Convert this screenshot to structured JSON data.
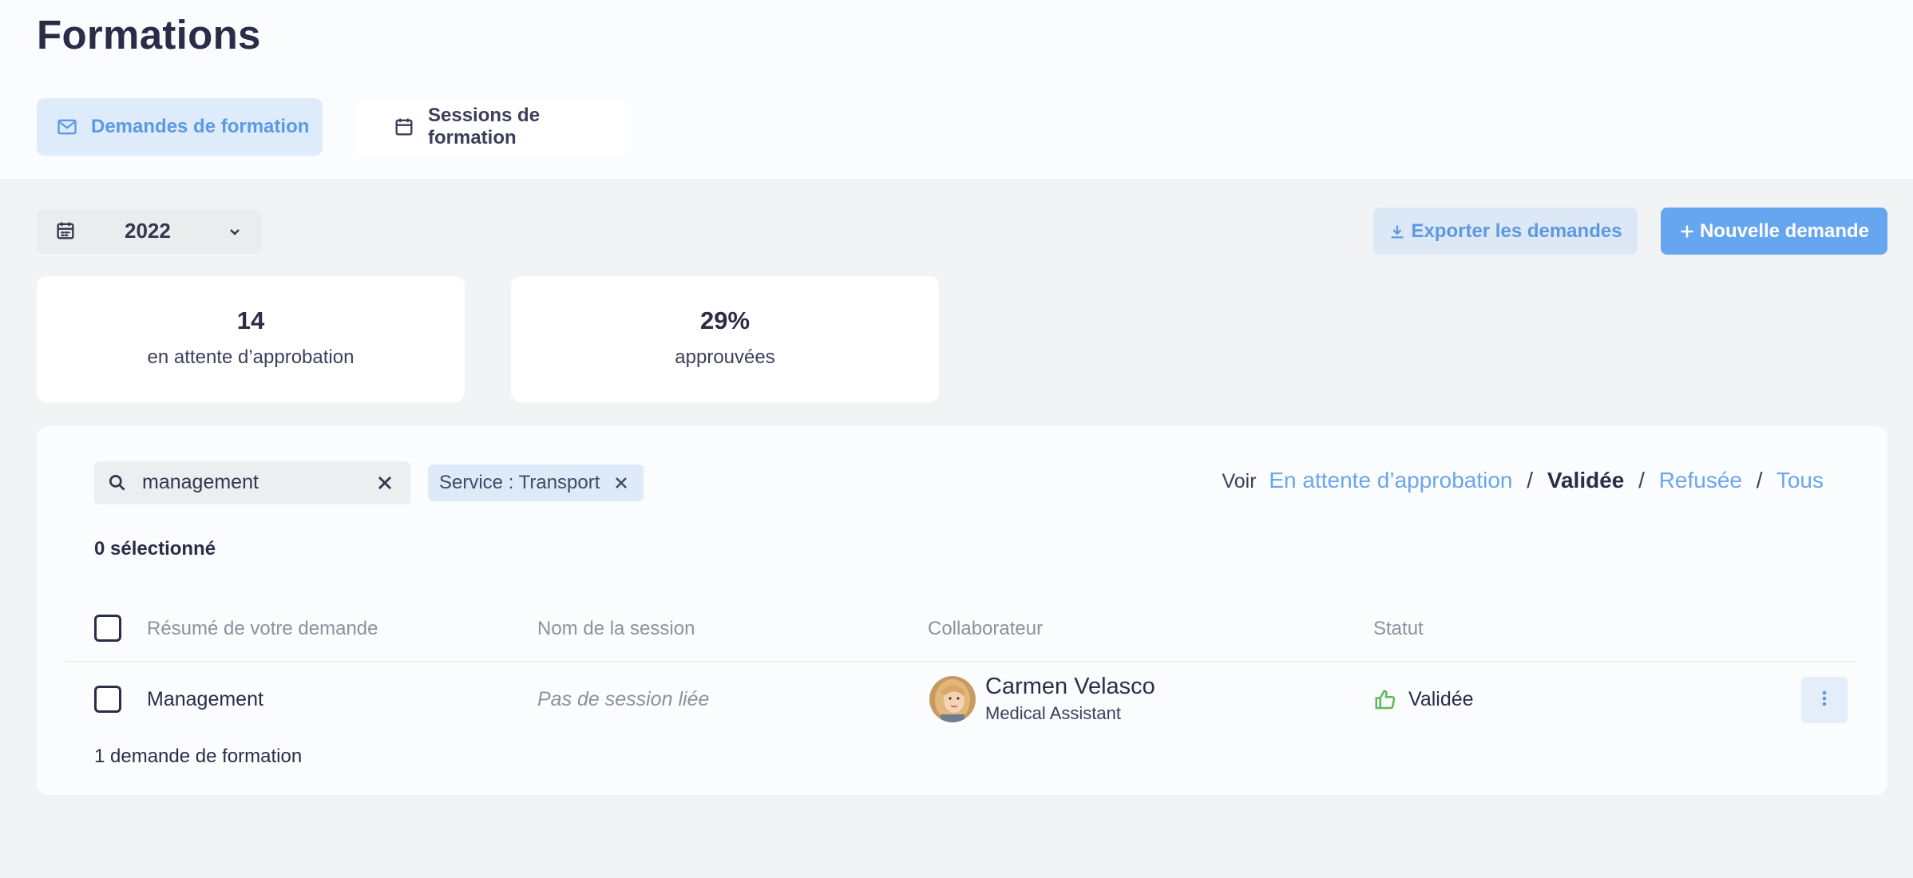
{
  "page": {
    "title": "Formations"
  },
  "tabs": [
    {
      "label": "Demandes de formation",
      "icon": "mail-icon",
      "active": true
    },
    {
      "label": "Sessions de formation",
      "icon": "calendar-icon",
      "active": false
    }
  ],
  "toolbar": {
    "year": "2022",
    "export_label": "Exporter les demandes",
    "new_label": "Nouvelle demande"
  },
  "stats": [
    {
      "value": "14",
      "label": "en attente d’approbation"
    },
    {
      "value": "29%",
      "label": "approuvées"
    }
  ],
  "filters": {
    "search_value": "management",
    "chip_label": "Service : Transport",
    "voir_label": "Voir",
    "status_options": [
      {
        "label": "En attente d’approbation",
        "active": false
      },
      {
        "label": "Validée",
        "active": true
      },
      {
        "label": "Refusée",
        "active": false
      },
      {
        "label": "Tous",
        "active": false
      }
    ],
    "separator": "/"
  },
  "selection": {
    "count_label": "0 sélectionné"
  },
  "table": {
    "columns": [
      "Résumé de votre demande",
      "Nom de la session",
      "Collaborateur",
      "Statut"
    ],
    "rows": [
      {
        "summary": "Management",
        "session": "Pas de session liée",
        "collaborator_name": "Carmen Velasco",
        "collaborator_role": "Medical Assistant",
        "status": "Validée"
      }
    ],
    "total_label": "1 demande de formation"
  },
  "colors": {
    "accent": "#66a5ef",
    "accent_light": "#deebfb",
    "approved_green": "#5cb85c",
    "text_dark": "#2a2d47"
  }
}
